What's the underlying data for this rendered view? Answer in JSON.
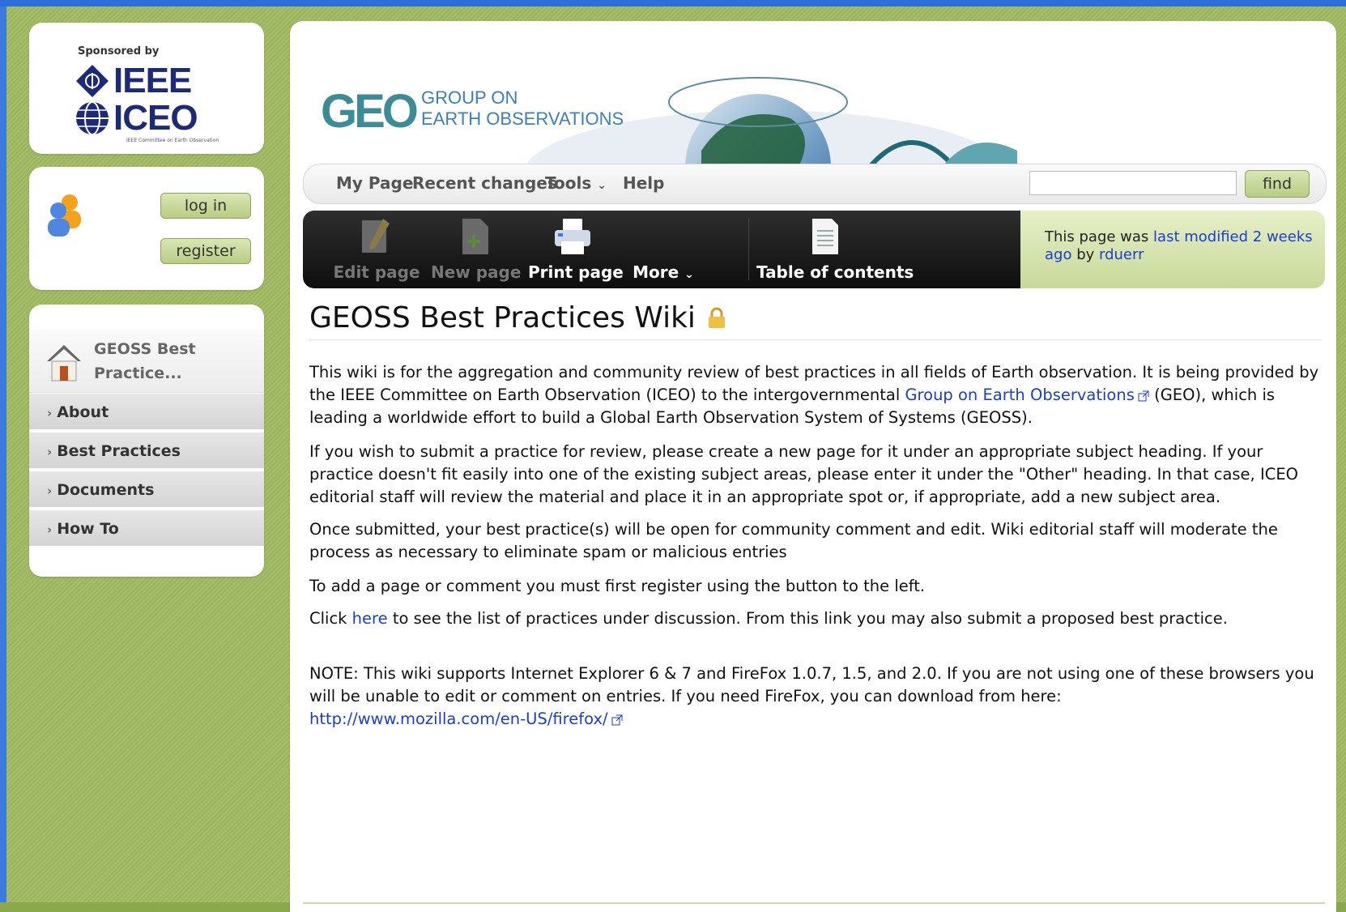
{
  "sponsor": {
    "label": "Sponsored by",
    "org1": "IEEE",
    "org2": "ICEO",
    "org2_sub": "IEEE Committee on Earth Observation"
  },
  "auth": {
    "login_label": "log in",
    "register_label": "register"
  },
  "nav": {
    "home_label_line1": "GEOSS Best",
    "home_label_line2": "Practice...",
    "items": [
      {
        "label": "About"
      },
      {
        "label": "Best Practices"
      },
      {
        "label": "Documents"
      },
      {
        "label": "How To"
      }
    ]
  },
  "banner": {
    "logo": "GEO",
    "title_line1": "GROUP ON",
    "title_line2": "EARTH OBSERVATIONS"
  },
  "toolbar": {
    "my_page": "My Page",
    "recent_changes": "Recent changes",
    "tools": "Tools",
    "help": "Help",
    "search_placeholder": "",
    "find_label": "find"
  },
  "actions": {
    "edit": "Edit page",
    "new": "New page",
    "print": "Print page",
    "more": "More",
    "toc": "Table of contents"
  },
  "modified": {
    "prefix": "This page was ",
    "link": "last modified 2 weeks ago",
    "by": " by ",
    "user": "rduerr"
  },
  "article": {
    "title": "GEOSS Best Practices Wiki",
    "p1_a": "This wiki is for the aggregation and community review of best practices in all fields of Earth observation. It is being provided by the IEEE Committee on Earth Observation (ICEO) to the intergovernmental ",
    "p1_link": "Group on Earth Observations",
    "p1_b": " (GEO), which is leading a worldwide effort to build a Global Earth Observation System of Systems (GEOSS).",
    "p2": "If you wish to submit a practice for review, please create a new page for it under an appropriate subject heading. If your practice doesn't fit easily into one of the existing subject areas, please enter it under the \"Other\" heading.  In that case, ICEO editorial staff will review the material and place it in an appropriate spot or, if appropriate, add a new subject area.",
    "p3": "Once submitted, your best practice(s) will be open for community comment and edit.  Wiki editorial staff will moderate the process as necessary to eliminate spam or malicious entries",
    "p4": "To add a page or comment you must first register using the button to the left.",
    "p5_a": "Click ",
    "p5_link": "here",
    "p5_b": " to see the list of practices under discussion. From this link you may also submit a proposed best practice.",
    "note": "NOTE: This wiki supports Internet Explorer 6 & 7  and FireFox 1.0.7, 1.5, and 2.0.  If you are not using one of these browsers you will be unable to edit or comment on entries.  If you need FireFox, you can download from here:",
    "note_link": "http://www.mozilla.com/en-US/firefox/"
  }
}
